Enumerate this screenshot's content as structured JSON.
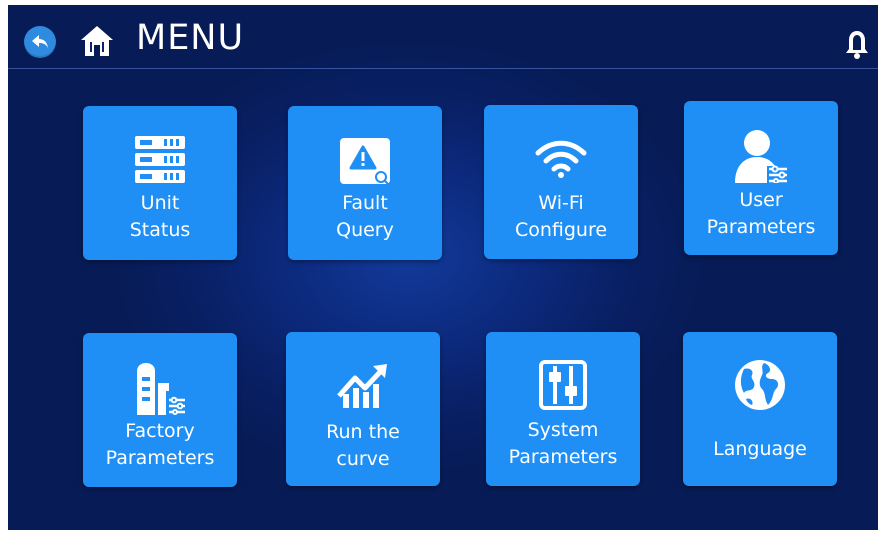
{
  "header": {
    "title": "MENU",
    "back_icon": "back-arrow-icon",
    "home_icon": "home-icon",
    "alarm_icon": "bell-icon"
  },
  "colors": {
    "background": "#0a246e",
    "tile": "#1f8ff5",
    "back_button": "#2f8be0",
    "text": "#ffffff"
  },
  "menu": {
    "items": [
      {
        "line1": "Unit",
        "line2": "Status",
        "icon": "server-rack-icon"
      },
      {
        "line1": "Fault",
        "line2": "Query",
        "icon": "warning-search-icon"
      },
      {
        "line1": "Wi-Fi",
        "line2": "Configure",
        "icon": "wifi-icon"
      },
      {
        "line1": "User",
        "line2": "Parameters",
        "icon": "user-settings-icon"
      },
      {
        "line1": "Factory",
        "line2": "Parameters",
        "icon": "factory-settings-icon"
      },
      {
        "line1": "Run the",
        "line2": "curve",
        "icon": "trend-chart-icon"
      },
      {
        "line1": "System",
        "line2": "Parameters",
        "icon": "sliders-icon"
      },
      {
        "line1": "Language",
        "line2": "",
        "icon": "globe-icon"
      }
    ]
  }
}
